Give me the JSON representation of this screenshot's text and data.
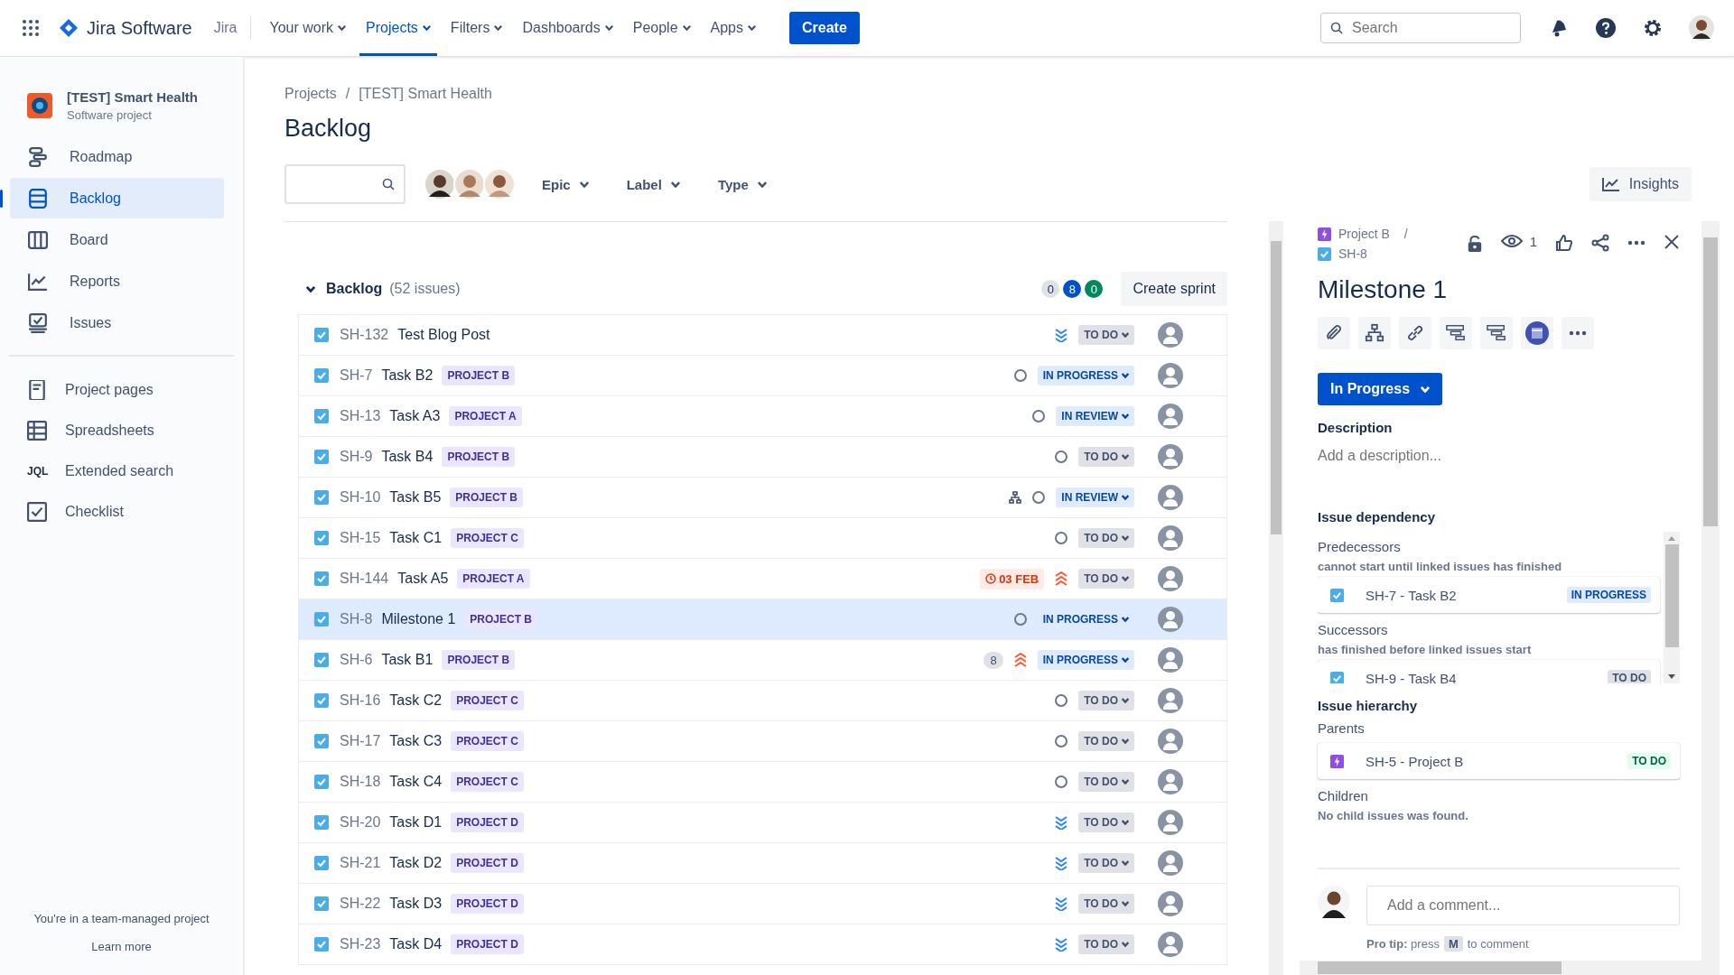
{
  "topbar": {
    "product": "Jira Software",
    "site": "Jira",
    "nav": [
      {
        "label": "Your work",
        "selected": false
      },
      {
        "label": "Projects",
        "selected": true
      },
      {
        "label": "Filters",
        "selected": false
      },
      {
        "label": "Dashboards",
        "selected": false
      },
      {
        "label": "People",
        "selected": false
      },
      {
        "label": "Apps",
        "selected": false
      }
    ],
    "create": "Create",
    "search": {
      "placeholder": "Search"
    }
  },
  "sidebar": {
    "project": {
      "name": "[TEST] Smart Health",
      "type": "Software project"
    },
    "items": [
      {
        "label": "Roadmap",
        "selected": false
      },
      {
        "label": "Backlog",
        "selected": true
      },
      {
        "label": "Board",
        "selected": false
      },
      {
        "label": "Reports",
        "selected": false
      },
      {
        "label": "Issues",
        "selected": false
      }
    ],
    "extra_items": [
      {
        "label": "Project pages"
      },
      {
        "label": "Spreadsheets"
      },
      {
        "label": "Extended search",
        "icon_text": "JQL"
      },
      {
        "label": "Checklist"
      }
    ],
    "footer": {
      "text": "You're in a team-managed project",
      "link": "Learn more"
    }
  },
  "header": {
    "breadcrumb": [
      "Projects",
      "/",
      "[TEST] Smart Health"
    ],
    "title": "Backlog",
    "filters": [
      "Epic",
      "Label",
      "Type"
    ],
    "insights": "Insights"
  },
  "backlog": {
    "title": "Backlog",
    "count": "(52 issues)",
    "counts": [
      {
        "value": "0",
        "kind": "todo"
      },
      {
        "value": "8",
        "kind": "progress"
      },
      {
        "value": "0",
        "kind": "done"
      }
    ],
    "create_sprint": "Create sprint",
    "rows": [
      {
        "key": "SH-132",
        "title": "Test Blog Post",
        "priority": {
          "kind": "lowest"
        },
        "status": {
          "label": "TO DO",
          "kind": "todo"
        },
        "selected": false
      },
      {
        "key": "SH-7",
        "title": "Task B2",
        "epic": "PROJECT B",
        "priority": {
          "kind": "medium"
        },
        "status": {
          "label": "IN PROGRESS",
          "kind": "progress"
        },
        "selected": false
      },
      {
        "key": "SH-13",
        "title": "Task A3",
        "epic": "PROJECT A",
        "priority": {
          "kind": "medium"
        },
        "status": {
          "label": "IN REVIEW",
          "kind": "progress"
        },
        "selected": false
      },
      {
        "key": "SH-9",
        "title": "Task B4",
        "epic": "PROJECT B",
        "priority": {
          "kind": "medium"
        },
        "status": {
          "label": "TO DO",
          "kind": "todo"
        },
        "selected": false
      },
      {
        "key": "SH-10",
        "title": "Task B5",
        "epic": "PROJECT B",
        "has_children": true,
        "priority": {
          "kind": "medium"
        },
        "status": {
          "label": "IN REVIEW",
          "kind": "progress"
        },
        "selected": false
      },
      {
        "key": "SH-15",
        "title": "Task C1",
        "epic": "PROJECT C",
        "priority": {
          "kind": "medium"
        },
        "status": {
          "label": "TO DO",
          "kind": "todo"
        },
        "selected": false
      },
      {
        "key": "SH-144",
        "title": "Task A5",
        "epic": "PROJECT A",
        "due": "03 FEB",
        "priority": {
          "kind": "highest"
        },
        "status": {
          "label": "TO DO",
          "kind": "todo"
        },
        "selected": false
      },
      {
        "key": "SH-8",
        "title": "Milestone 1",
        "epic": "PROJECT B",
        "priority": {
          "kind": "medium"
        },
        "status": {
          "label": "IN PROGRESS",
          "kind": "progress"
        },
        "selected": true
      },
      {
        "key": "SH-6",
        "title": "Task B1",
        "epic": "PROJECT B",
        "estimate": "8",
        "priority": {
          "kind": "highest"
        },
        "status": {
          "label": "IN PROGRESS",
          "kind": "progress"
        },
        "selected": false
      },
      {
        "key": "SH-16",
        "title": "Task C2",
        "epic": "PROJECT C",
        "priority": {
          "kind": "medium"
        },
        "status": {
          "label": "TO DO",
          "kind": "todo"
        },
        "selected": false
      },
      {
        "key": "SH-17",
        "title": "Task C3",
        "epic": "PROJECT C",
        "priority": {
          "kind": "medium"
        },
        "status": {
          "label": "TO DO",
          "kind": "todo"
        },
        "selected": false
      },
      {
        "key": "SH-18",
        "title": "Task C4",
        "epic": "PROJECT C",
        "priority": {
          "kind": "medium"
        },
        "status": {
          "label": "TO DO",
          "kind": "todo"
        },
        "selected": false
      },
      {
        "key": "SH-20",
        "title": "Task D1",
        "epic": "PROJECT D",
        "priority": {
          "kind": "lowest"
        },
        "status": {
          "label": "TO DO",
          "kind": "todo"
        },
        "selected": false
      },
      {
        "key": "SH-21",
        "title": "Task D2",
        "epic": "PROJECT D",
        "priority": {
          "kind": "lowest"
        },
        "status": {
          "label": "TO DO",
          "kind": "todo"
        },
        "selected": false
      },
      {
        "key": "SH-22",
        "title": "Task D3",
        "epic": "PROJECT D",
        "priority": {
          "kind": "lowest"
        },
        "status": {
          "label": "TO DO",
          "kind": "todo"
        },
        "selected": false
      },
      {
        "key": "SH-23",
        "title": "Task D4",
        "epic": "PROJECT D",
        "priority": {
          "kind": "lowest"
        },
        "status": {
          "label": "TO DO",
          "kind": "todo"
        },
        "selected": false
      }
    ]
  },
  "detail": {
    "breadcrumb": [
      "Project B",
      "/",
      "SH-8"
    ],
    "watchers": "1",
    "title": "Milestone 1",
    "status": "In Progress",
    "description": {
      "label": "Description",
      "placeholder": "Add a description..."
    },
    "dependency": {
      "title": "Issue dependency",
      "groups": [
        {
          "label": "Predecessors",
          "hint": "cannot start until linked issues has finished",
          "issue": {
            "text": "SH-7 - Task B2",
            "status": {
              "label": "IN PROGRESS",
              "kind": "progress"
            }
          }
        },
        {
          "label": "Successors",
          "hint": "has finished before linked issues start",
          "issue": {
            "text": "SH-9 - Task B4",
            "status": {
              "label": "TO DO",
              "kind": "todo"
            }
          }
        }
      ]
    },
    "hierarchy": {
      "title": "Issue hierarchy",
      "parents_label": "Parents",
      "parent": {
        "text": "SH-5 - Project B",
        "status": {
          "label": "TO DO",
          "kind": "done"
        }
      },
      "children_label": "Children",
      "children_empty": "No child issues was found."
    },
    "comment": {
      "placeholder": "Add a comment...",
      "tip": "**Pro tip:** press",
      "key": "M",
      "tip_end": "to comment"
    }
  }
}
